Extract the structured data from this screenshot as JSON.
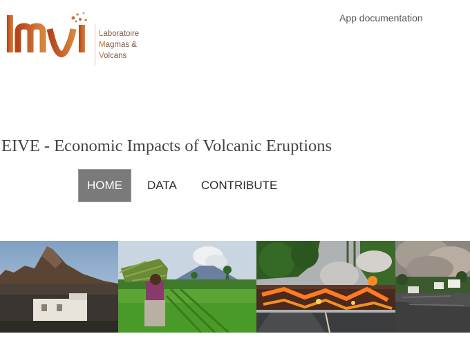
{
  "header": {
    "logo": {
      "mark": "lmv",
      "lines": [
        {
          "initial": "L",
          "rest": "aboratoire"
        },
        {
          "initial": "M",
          "rest": "agmas &"
        },
        {
          "initial": "V",
          "rest": "olcans"
        }
      ]
    },
    "doc_link": "App documentation"
  },
  "page_title": "EIVE - Economic Impacts of Volcanic Eruptions",
  "nav": {
    "items": [
      {
        "label": "HOME",
        "active": true
      },
      {
        "label": "DATA",
        "active": false
      },
      {
        "label": "CONTRIBUTE",
        "active": false
      }
    ]
  },
  "colors": {
    "brand_orange": "#c76a2a",
    "brand_dark": "#8a3a1a",
    "nav_active_bg": "#7a7a7a"
  },
  "photos": [
    {
      "subject": "volcano-cone-with-building"
    },
    {
      "subject": "farmer-carrying-crops-erupting-volcano"
    },
    {
      "subject": "lava-flow-crossing-road"
    },
    {
      "subject": "ash-plume-over-houses"
    }
  ]
}
